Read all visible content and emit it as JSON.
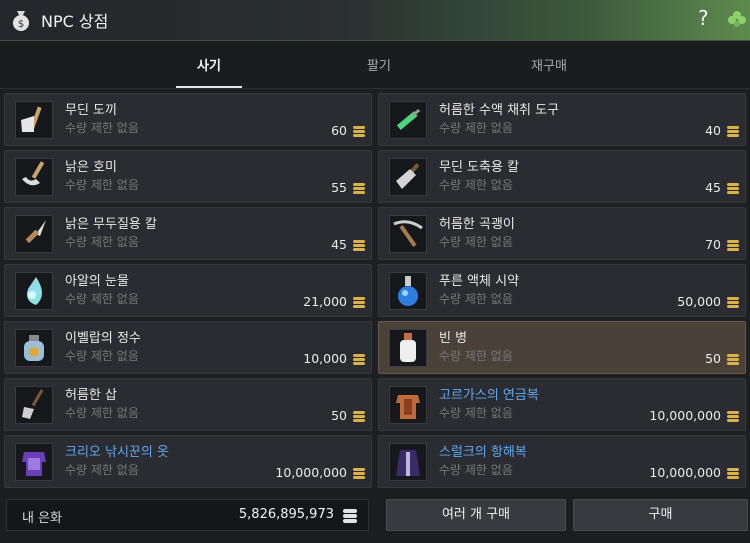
{
  "window": {
    "title": "NPC 상점",
    "help_label": "?"
  },
  "tabs": [
    {
      "label": "사기",
      "active": true
    },
    {
      "label": "팔기",
      "active": false
    },
    {
      "label": "재구매",
      "active": false
    }
  ],
  "items": [
    {
      "name": "무딘 도끼",
      "limit": "수량 제한 없음",
      "price": "60",
      "icon": "axe-icon"
    },
    {
      "name": "허름한 수액 채취 도구",
      "limit": "수량 제한 없음",
      "price": "40",
      "icon": "syringe-icon"
    },
    {
      "name": "낡은 호미",
      "limit": "수량 제한 없음",
      "price": "55",
      "icon": "hoe-icon"
    },
    {
      "name": "무딘 도축용 칼",
      "limit": "수량 제한 없음",
      "price": "45",
      "icon": "cleaver-icon"
    },
    {
      "name": "낡은 무두질용 칼",
      "limit": "수량 제한 없음",
      "price": "45",
      "icon": "knife-icon"
    },
    {
      "name": "허름한 곡괭이",
      "limit": "수량 제한 없음",
      "price": "70",
      "icon": "pickaxe-icon"
    },
    {
      "name": "아알의 눈물",
      "limit": "수량 제한 없음",
      "price": "21,000",
      "icon": "teardrop-icon"
    },
    {
      "name": "푸른 액체 시약",
      "limit": "수량 제한 없음",
      "price": "50,000",
      "icon": "flask-icon"
    },
    {
      "name": "이벨랍의 정수",
      "limit": "수량 제한 없음",
      "price": "10,000",
      "icon": "jar-icon"
    },
    {
      "name": "빈 병",
      "limit": "수량 제한 없음",
      "price": "50",
      "icon": "bottle-icon"
    },
    {
      "name": "허름한 삽",
      "limit": "수량 제한 없음",
      "price": "50",
      "icon": "shovel-icon"
    },
    {
      "name": "고르가스의 연금복",
      "limit": "수량 제한 없음",
      "price": "10,000,000",
      "icon": "armor-icon"
    },
    {
      "name": "크리오 낚시꾼의 옷",
      "limit": "수량 제한 없음",
      "price": "10,000,000",
      "icon": "outfit-icon"
    },
    {
      "name": "스럴크의 항해복",
      "limit": "수량 제한 없음",
      "price": "10,000,000",
      "icon": "robe-icon"
    }
  ],
  "footer": {
    "silver_label": "내 은화",
    "silver_value": "5,826,895,973",
    "buy_multiple_label": "여러 개 구매",
    "buy_label": "구매"
  },
  "colors": {
    "accent_blue": "#5fa8ee",
    "selected_bg": "#4a4139",
    "coin": "#d9b24a"
  }
}
